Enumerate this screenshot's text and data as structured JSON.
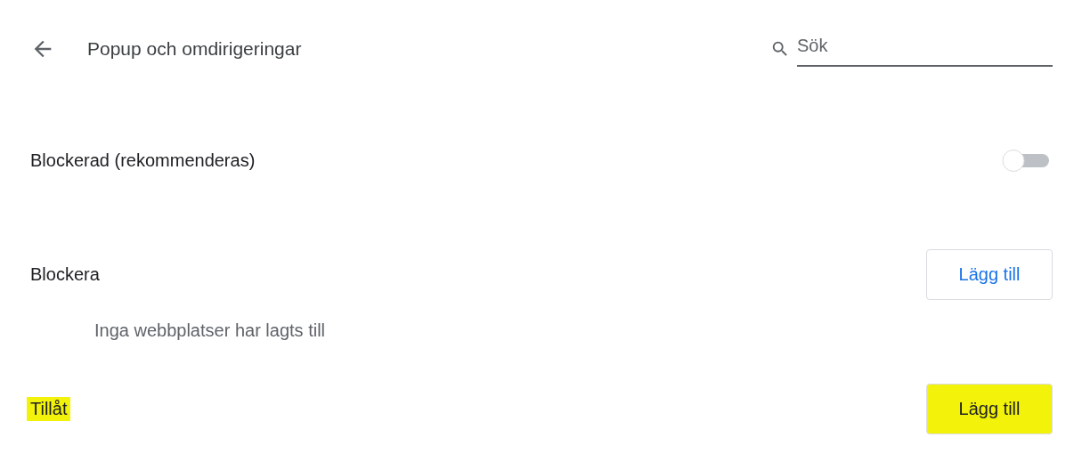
{
  "header": {
    "title": "Popup och omdirigeringar",
    "search": {
      "placeholder": "Sök"
    }
  },
  "setting": {
    "label": "Blockerad (rekommenderas)",
    "on": false
  },
  "sections": [
    {
      "label": "Blockera",
      "highlighted": false,
      "button": {
        "label": "Lägg till",
        "highlighted": false
      },
      "empty_text": "Inga webbplatser har lagts till"
    },
    {
      "label": "Tillåt",
      "highlighted": true,
      "button": {
        "label": "Lägg till",
        "highlighted": true
      }
    }
  ]
}
